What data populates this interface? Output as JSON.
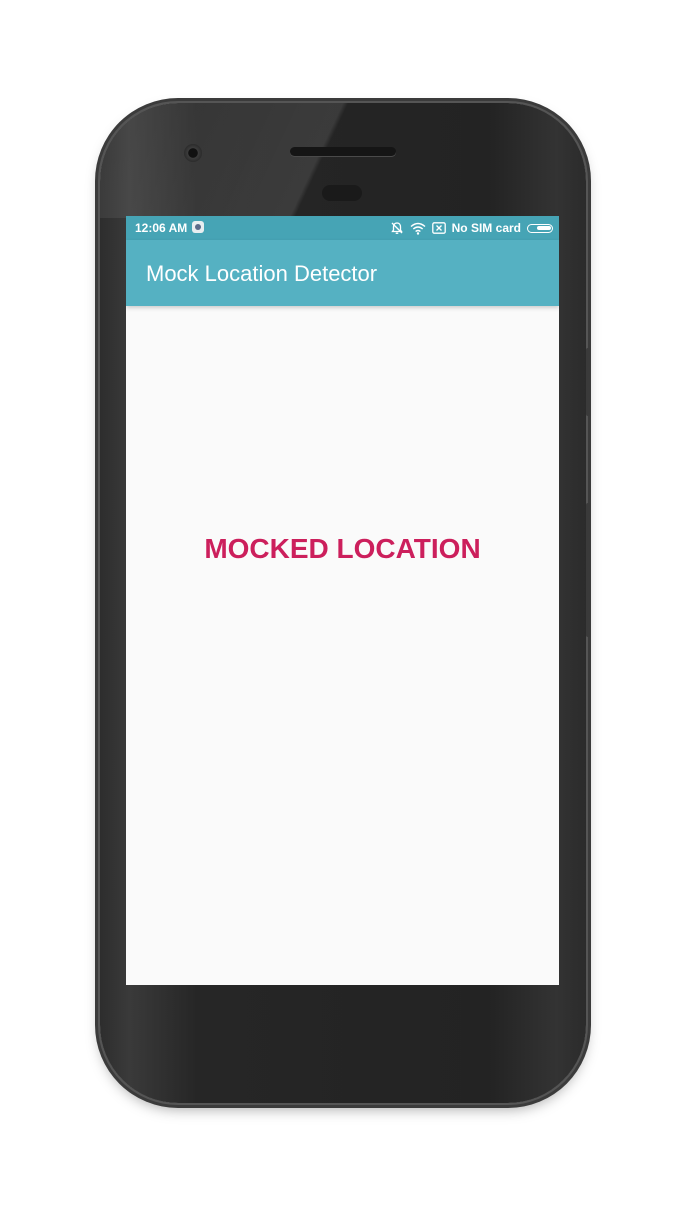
{
  "status_bar": {
    "time": "12:06 AM",
    "sim_text": "No SIM card",
    "icons": [
      "app-notification-icon",
      "alarm-off-icon",
      "wifi-icon",
      "sim-x-icon",
      "battery-icon"
    ]
  },
  "app_bar": {
    "title": "Mock Location Detector"
  },
  "main": {
    "message": "MOCKED LOCATION"
  },
  "colors": {
    "status_bar": "#46a4b5",
    "app_bar": "#55b1c2",
    "message": "#cc1f5c",
    "background": "#fafafa"
  }
}
